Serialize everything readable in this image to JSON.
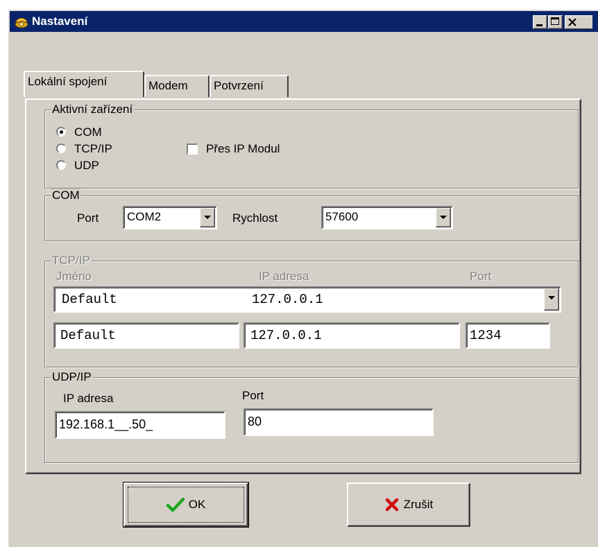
{
  "window": {
    "title": "Nastavení",
    "icon": "phone-icon"
  },
  "tabs": [
    {
      "label": "Lokální spojení",
      "active": true
    },
    {
      "label": "Modem",
      "active": false
    },
    {
      "label": "Potvrzení",
      "active": false
    }
  ],
  "active_device": {
    "legend": "Aktivní zařízení",
    "options": [
      "COM",
      "TCP/IP",
      "UDP"
    ],
    "selected": "COM",
    "ip_module_label": "Přes IP Modul",
    "ip_module_checked": false
  },
  "com": {
    "legend": "COM",
    "port_label": "Port",
    "port_value": "COM2",
    "speed_label": "Rychlost",
    "speed_value": "57600"
  },
  "tcpip": {
    "legend": "TCP/IP",
    "name_header": "Jméno",
    "ip_header": "IP adresa",
    "port_header": "Port",
    "combo_name": "Default",
    "combo_ip": "127.0.0.1",
    "name_value": "Default",
    "ip_value": "127.0.0.1",
    "port_value": "1234"
  },
  "udpip": {
    "legend": "UDP/IP",
    "ip_label": "IP adresa",
    "port_label": "Port",
    "ip_value": "192.168.1__.50_",
    "port_value": "80"
  },
  "buttons": {
    "ok_label": "OK",
    "cancel_label": "Zrušit"
  },
  "colors": {
    "titlebar": "#0a246a",
    "face": "#d4d0c8",
    "ok_check": "#1ea81e",
    "cancel_x": "#d01010"
  }
}
